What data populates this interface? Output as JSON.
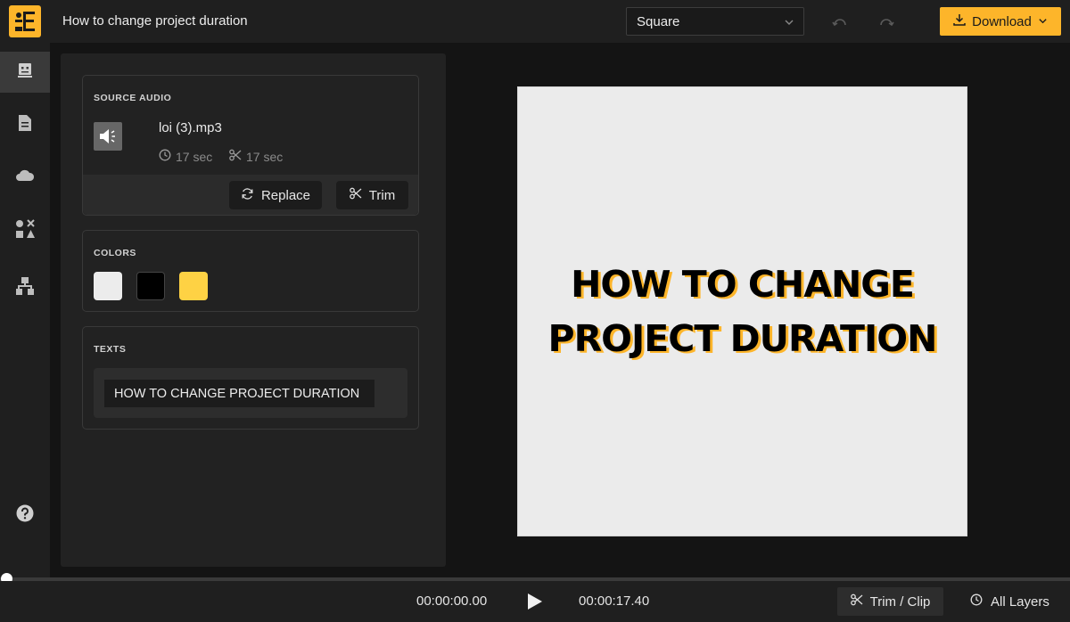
{
  "header": {
    "title": "How to change project duration",
    "format_select": {
      "value": "Square"
    },
    "download_label": "Download"
  },
  "sidebar": {
    "items": [
      {
        "icon": "robot-face-icon",
        "active": true
      },
      {
        "icon": "document-icon",
        "active": false
      },
      {
        "icon": "cloud-icon",
        "active": false
      },
      {
        "icon": "shapes-icon",
        "active": false
      },
      {
        "icon": "hierarchy-icon",
        "active": false
      }
    ],
    "help_icon": "help-icon"
  },
  "panel": {
    "source_audio": {
      "title": "SOURCE AUDIO",
      "file_name": "loi (3).mp3",
      "duration": "17 sec",
      "trimmed_duration": "17 sec",
      "replace_label": "Replace",
      "trim_label": "Trim"
    },
    "colors": {
      "title": "COLORS",
      "swatches": [
        "#ececec",
        "#000000",
        "#fed244"
      ]
    },
    "texts": {
      "title": "TEXTS",
      "items": [
        "HOW TO CHANGE PROJECT DURATION"
      ]
    }
  },
  "canvas": {
    "headline_line1": "HOW TO CHANGE",
    "headline_line2": "PROJECT DURATION",
    "background": "#ebebeb",
    "text_color": "#000000",
    "shadow_color": "#fdb52a"
  },
  "timeline": {
    "current_time": "00:00:00.00",
    "total_time": "00:00:17.40",
    "progress": 0,
    "trim_clip_label": "Trim / Clip",
    "all_layers_label": "All Layers"
  },
  "colors": {
    "accent": "#fdb52a",
    "background": "#141414",
    "panel": "#222222"
  }
}
